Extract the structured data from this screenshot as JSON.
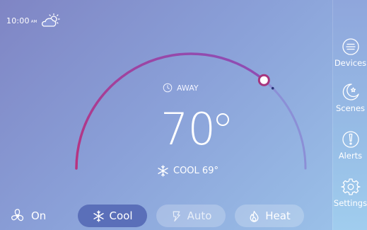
{
  "status": {
    "time": "10:00",
    "ampm": "AM",
    "weather_icon": "partly-sunny-icon"
  },
  "dial": {
    "track_color": "#8b8fd6",
    "active_color_start": "#b8337f",
    "active_color_end": "#8b50b8",
    "setpoint_fraction": 0.72
  },
  "away": {
    "label": "AWAY",
    "icon": "clock-icon"
  },
  "temperature": {
    "value": "70"
  },
  "mode_status": {
    "label": "COOL 69°",
    "icon": "snowflake-icon"
  },
  "fan": {
    "label": "On",
    "icon": "fan-icon"
  },
  "modes": {
    "cool": {
      "label": "Cool",
      "icon": "snowflake-icon",
      "selected": true
    },
    "auto": {
      "label": "Auto",
      "icon": "auto-icon",
      "selected": false
    },
    "heat": {
      "label": "Heat",
      "icon": "flame-icon",
      "selected": false
    }
  },
  "sidebar": {
    "device": "Devices",
    "scenes": "Scenes",
    "alerts": "Alerts",
    "settings": "Settings"
  }
}
